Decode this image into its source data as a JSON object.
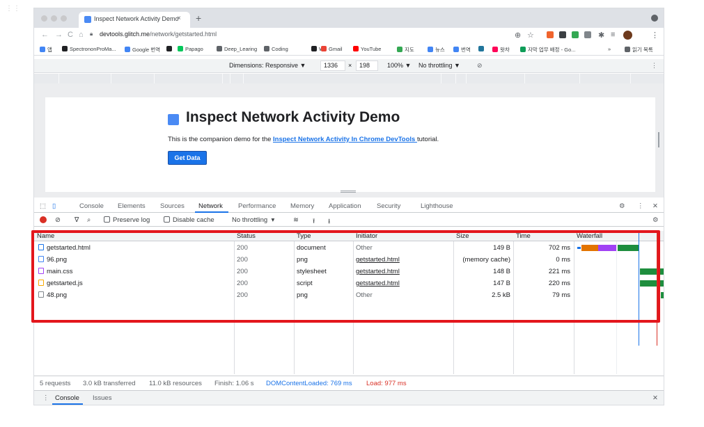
{
  "browser": {
    "tab_title": "Inspect Network Activity Demo",
    "tab_close": "×",
    "new_tab": "+",
    "url_host": "devtools.glitch.me",
    "url_path": "/network/getstarted.html",
    "bookmarks": [
      {
        "label": "앱",
        "color": "#4285f4"
      },
      {
        "label": "SpectrononProMa...",
        "color": "#202124"
      },
      {
        "label": "Google 번역",
        "color": "#4285f4"
      },
      {
        "label": "",
        "color": "#202124"
      },
      {
        "label": "Papago",
        "color": "#03c75a"
      },
      {
        "label": "Deep_Learing",
        "color": "#5f6368"
      },
      {
        "label": "Coding",
        "color": "#5f6368"
      },
      {
        "label": "W",
        "color": "#202124"
      },
      {
        "label": "Gmail",
        "color": "#ea4335"
      },
      {
        "label": "YouTube",
        "color": "#ff0000"
      },
      {
        "label": "지도",
        "color": "#34a853"
      },
      {
        "label": "뉴스",
        "color": "#4285f4"
      },
      {
        "label": "번역",
        "color": "#4285f4"
      },
      {
        "label": "",
        "color": "#21759b"
      },
      {
        "label": "왓챠",
        "color": "#ff0558"
      },
      {
        "label": "자막 업무 배정 - Go...",
        "color": "#0f9d58"
      }
    ],
    "bookmarks_more": "»",
    "reading_list": "읽기 목록"
  },
  "device_toolbar": {
    "dimensions_label": "Dimensions: Responsive ▼",
    "width": "1336",
    "times": "×",
    "height": "198",
    "zoom": "100% ▼",
    "throttling": "No throttling ▼"
  },
  "page": {
    "heading": "Inspect Network Activity Demo",
    "desc_prefix": "This is the companion demo for the ",
    "desc_link": "Inspect Network Activity In Chrome DevTools ",
    "desc_suffix": "tutorial.",
    "button": "Get Data"
  },
  "devtools": {
    "tabs": [
      "Console",
      "Elements",
      "Sources",
      "Network",
      "Performance",
      "Memory",
      "Application",
      "Security",
      "Lighthouse"
    ],
    "active_tab": "Network",
    "preserve_log": "Preserve log",
    "disable_cache": "Disable cache",
    "throttling": "No throttling",
    "columns": [
      "Name",
      "Status",
      "Type",
      "Initiator",
      "Size",
      "Time",
      "Waterfall"
    ],
    "rows": [
      {
        "name": "getstarted.html",
        "status": "200",
        "type": "document",
        "initiator": "Other",
        "size": "149 B",
        "time": "702 ms",
        "icon_color": "#1a73e8"
      },
      {
        "name": "96.png",
        "status": "200",
        "type": "png",
        "initiator": "getstarted.html",
        "size": "(memory cache)",
        "time": "0 ms",
        "icon_color": "#4285f4"
      },
      {
        "name": "main.css",
        "status": "200",
        "type": "stylesheet",
        "initiator": "getstarted.html",
        "size": "148 B",
        "time": "221 ms",
        "icon_color": "#a142f4"
      },
      {
        "name": "getstarted.js",
        "status": "200",
        "type": "script",
        "initiator": "getstarted.html",
        "size": "147 B",
        "time": "220 ms",
        "icon_color": "#f9ab00"
      },
      {
        "name": "48.png",
        "status": "200",
        "type": "png",
        "initiator": "Other",
        "size": "2.5 kB",
        "time": "79 ms",
        "icon_color": "#80868b"
      }
    ],
    "status": {
      "requests": "5 requests",
      "transferred": "3.0 kB transferred",
      "resources": "11.0 kB resources",
      "finish": "Finish: 1.06 s",
      "dcl": "DOMContentLoaded: 769 ms",
      "load": "Load: 977 ms"
    },
    "drawer_tabs": [
      "Console",
      "Issues"
    ],
    "colors": {
      "dcl": "#1a73e8",
      "load": "#d93025",
      "highlight": "#e3161c"
    }
  }
}
